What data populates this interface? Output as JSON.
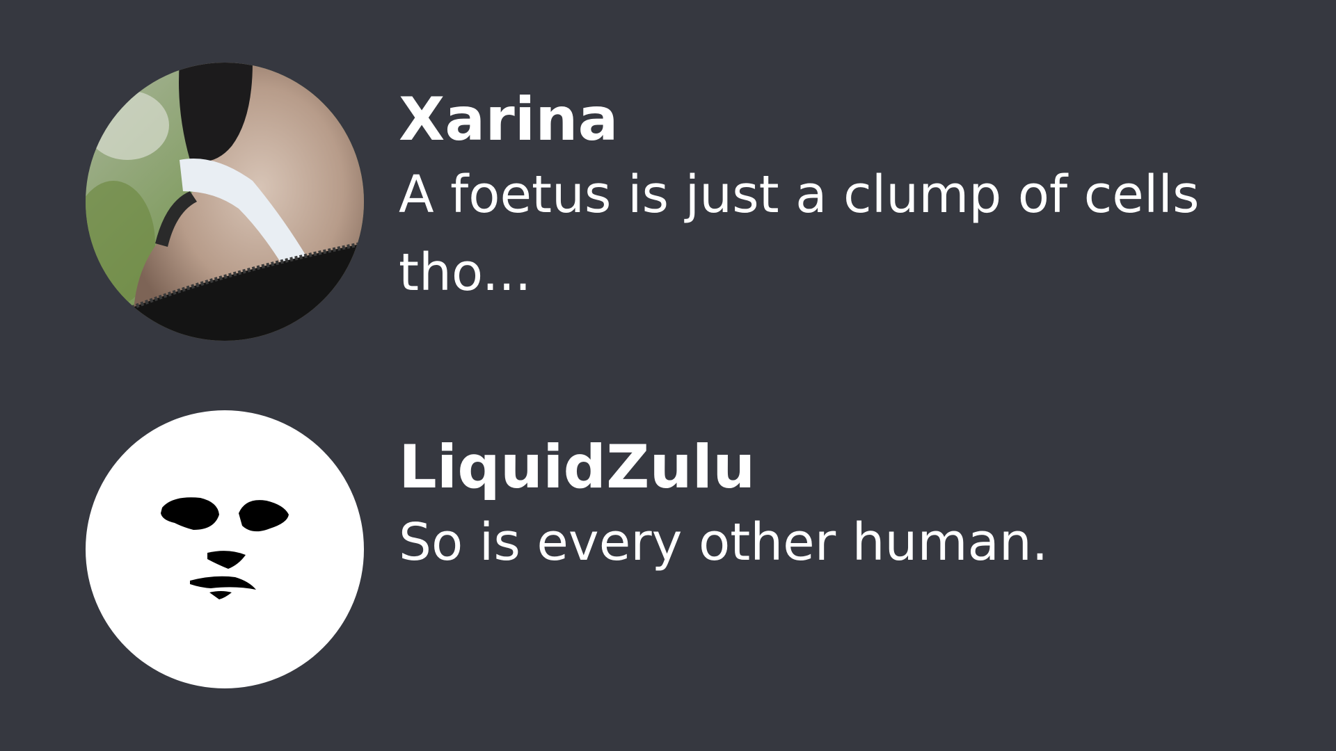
{
  "colors": {
    "background": "#363840",
    "text": "#ffffff"
  },
  "messages": [
    {
      "username": "Xarina",
      "text": "A foetus is just a clump of cells tho...",
      "avatar_icon": "photo-avatar-shoulder"
    },
    {
      "username": "LiquidZulu",
      "text": "So is every other human.",
      "avatar_icon": "face-sketch-avatar"
    }
  ]
}
